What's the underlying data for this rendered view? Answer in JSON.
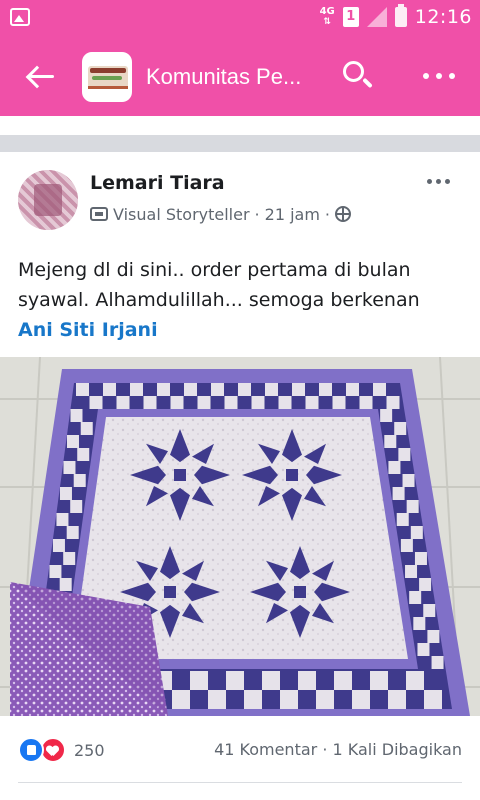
{
  "status_bar": {
    "network": "4G",
    "sim": "1",
    "time": "12:16"
  },
  "app_bar": {
    "group_title": "Komunitas Pe...",
    "back_icon": "arrow-left-icon",
    "search_icon": "search-icon",
    "more_icon": "more-horizontal-icon",
    "background": "#f050a8"
  },
  "post": {
    "author": "Lemari Tiara",
    "badge": "Visual Storyteller",
    "time": "21 jam",
    "privacy_icon": "globe-icon",
    "text": "Mejeng dl di sini.. order pertama di bulan syawal. Alhamdulillah... semoga berkenan",
    "tagged": "Ani Siti Irjani",
    "photo_subject": "quilt-photo",
    "reactions": {
      "count": "250",
      "icons": [
        "like-icon",
        "love-icon"
      ]
    },
    "comments": "41 Komentar",
    "shares": "1 Kali Dibagikan"
  },
  "colors": {
    "brand": "#f050a8",
    "link": "#1877c9",
    "secondary_text": "#606770",
    "quilt_purple": "#8070c8",
    "quilt_navy": "#3f3a8c"
  }
}
